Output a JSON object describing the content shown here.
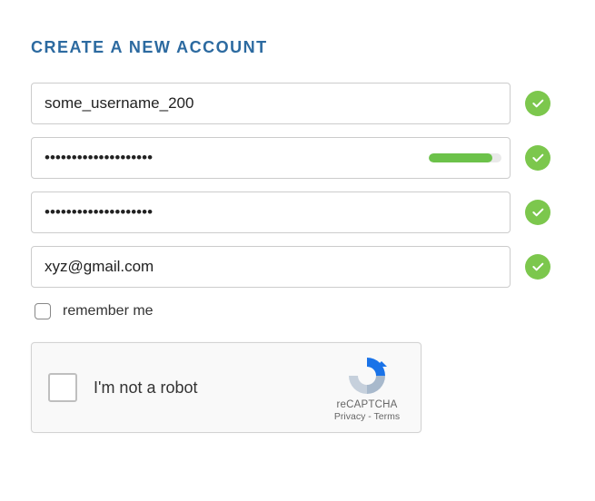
{
  "title": "CREATE A NEW ACCOUNT",
  "fields": {
    "username": {
      "value": "some_username_200",
      "valid": true
    },
    "password": {
      "value": "••••••••••••••••••••",
      "valid": true,
      "strength_pct": 88
    },
    "confirm": {
      "value": "••••••••••••••••••••",
      "valid": true
    },
    "email": {
      "value": "xyz@gmail.com",
      "valid": true
    }
  },
  "remember": {
    "label": "remember me",
    "checked": false
  },
  "recaptcha": {
    "label": "I'm not a robot",
    "brand": "reCAPTCHA",
    "privacy": "Privacy",
    "terms": "Terms",
    "separator": " - "
  }
}
